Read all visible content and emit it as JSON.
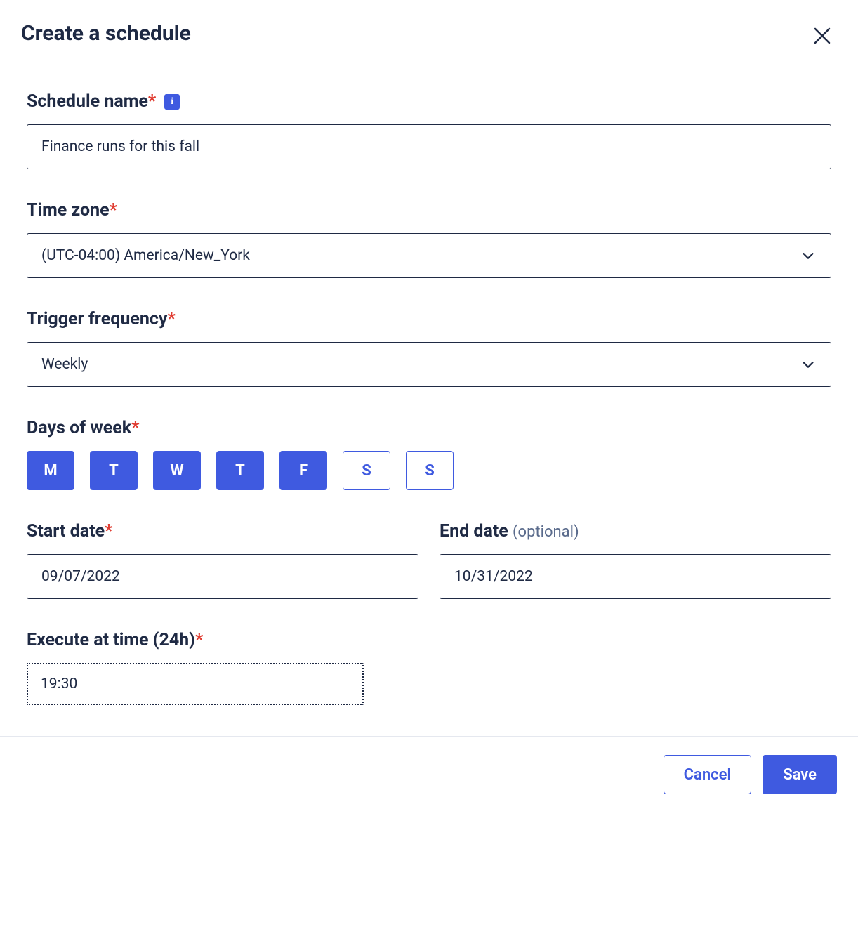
{
  "dialog": {
    "title": "Create a schedule"
  },
  "fields": {
    "scheduleName": {
      "label": "Schedule name",
      "value": "Finance runs for this fall"
    },
    "timezone": {
      "label": "Time zone",
      "value": "(UTC-04:00) America/New_York"
    },
    "triggerFrequency": {
      "label": "Trigger frequency",
      "value": "Weekly"
    },
    "daysOfWeek": {
      "label": "Days of week",
      "days": [
        {
          "label": "M",
          "selected": true
        },
        {
          "label": "T",
          "selected": true
        },
        {
          "label": "W",
          "selected": true
        },
        {
          "label": "T",
          "selected": true
        },
        {
          "label": "F",
          "selected": true
        },
        {
          "label": "S",
          "selected": false
        },
        {
          "label": "S",
          "selected": false
        }
      ]
    },
    "startDate": {
      "label": "Start date",
      "value": "09/07/2022"
    },
    "endDate": {
      "label": "End date",
      "optional": "(optional)",
      "value": "10/31/2022"
    },
    "executeTime": {
      "label": "Execute at time (24h)",
      "value": "19:30"
    }
  },
  "footer": {
    "cancel": "Cancel",
    "save": "Save"
  },
  "info": {
    "glyph": "i"
  }
}
